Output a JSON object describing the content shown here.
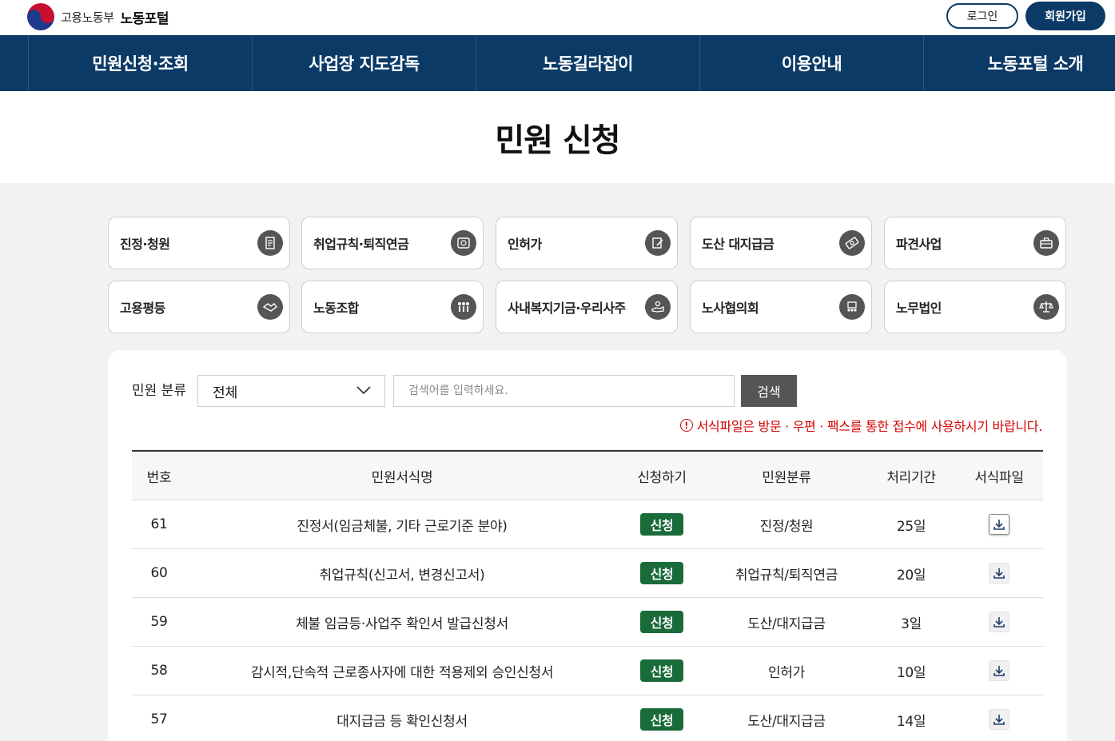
{
  "header": {
    "ministry": "고용노동부",
    "portal": "노동포털",
    "login_label": "로그인",
    "join_label": "회원가입"
  },
  "nav": {
    "items": [
      {
        "label": "민원신청·조회"
      },
      {
        "label": "사업장 지도감독"
      },
      {
        "label": "노동길라잡이"
      },
      {
        "label": "이용안내"
      },
      {
        "label": "노동포털 소개"
      }
    ]
  },
  "page": {
    "title": "민원 신청"
  },
  "categories": [
    {
      "label": "진정·청원",
      "icon": "petition-icon"
    },
    {
      "label": "취업규칙·퇴직연금",
      "icon": "money-document-icon"
    },
    {
      "label": "인허가",
      "icon": "approval-pen-icon"
    },
    {
      "label": "도산 대지급금",
      "icon": "cash-icon"
    },
    {
      "label": "파견사업",
      "icon": "briefcase-icon"
    },
    {
      "label": "고용평등",
      "icon": "handshake-icon"
    },
    {
      "label": "노동조합",
      "icon": "people-group-icon"
    },
    {
      "label": "사내복지기금·우리사주",
      "icon": "hand-coin-icon"
    },
    {
      "label": "노사협의회",
      "icon": "meeting-icon"
    },
    {
      "label": "노무법인",
      "icon": "scales-icon"
    }
  ],
  "filter": {
    "label": "민원 분류",
    "selected": "전체",
    "search_placeholder": "검색어를 입력하세요.",
    "search_button": "검색"
  },
  "notice": {
    "icon_glyph": "!",
    "text": "서식파일은 방문 · 우편 · 팩스를 통한 접수에 사용하시기 바랍니다."
  },
  "table": {
    "headers": {
      "no": "번호",
      "name": "민원서식명",
      "apply": "신청하기",
      "category": "민원분류",
      "period": "처리기간",
      "file": "서식파일"
    },
    "rows": [
      {
        "no": "61",
        "name": "진정서(임금체불, 기타 근로기준 분야)",
        "apply": "신청",
        "category": "진정/청원",
        "period": "25일"
      },
      {
        "no": "60",
        "name": "취업규칙(신고서, 변경신고서)",
        "apply": "신청",
        "category": "취업규칙/퇴직연금",
        "period": "20일"
      },
      {
        "no": "59",
        "name": "체불 임금등·사업주 확인서 발급신청서",
        "apply": "신청",
        "category": "도산/대지급금",
        "period": "3일"
      },
      {
        "no": "58",
        "name": "감시적,단속적 근로종사자에 대한 적용제외 승인신청서",
        "apply": "신청",
        "category": "인허가",
        "period": "10일"
      },
      {
        "no": "57",
        "name": "대지급금 등 확인신청서",
        "apply": "신청",
        "category": "도산/대지급금",
        "period": "14일"
      }
    ]
  },
  "colors": {
    "navy": "#0b3a66",
    "apply_green": "#1a6b3a",
    "notice_red": "#d40000"
  }
}
